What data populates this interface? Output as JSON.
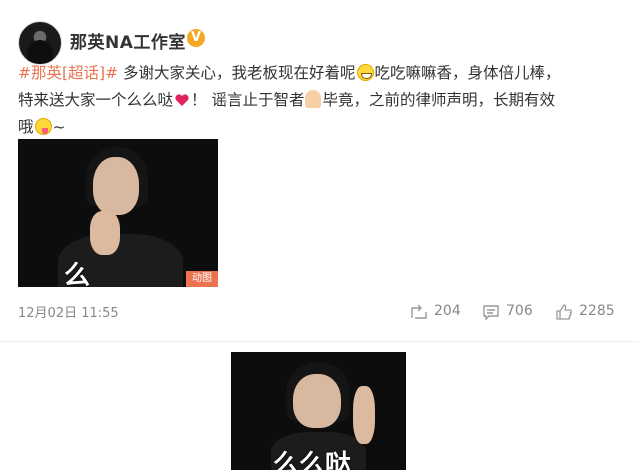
{
  "post": {
    "author": "那英NA工作室",
    "verified_badge": "V",
    "text": {
      "topic": "#那英[超话]#",
      "line1a": " 多谢大家关心，我老板现在好着呢",
      "line1b": "吃吃嘛嘛香，身体倍儿棒，",
      "line2a": "特来送大家一个么么哒",
      "line2b": "！ 谣言止于智者",
      "line2c": "毕竟，之前的律师声明，长期有效",
      "line3a": "哦",
      "line3b": "~"
    },
    "emojis": [
      "grin-emoji",
      "heart-emoji",
      "pray-emoji",
      "tongue-emoji"
    ],
    "image1": {
      "caption": "么",
      "badge": "动图"
    },
    "timestamp": "12月02日 11:55",
    "actions": {
      "forward_count": "204",
      "comment_count": "706",
      "like_count": "2285"
    }
  },
  "image2": {
    "caption": "么么哒"
  },
  "colors": {
    "topic": "#eb7350",
    "badge": "#f5a623",
    "meta": "#888888"
  }
}
